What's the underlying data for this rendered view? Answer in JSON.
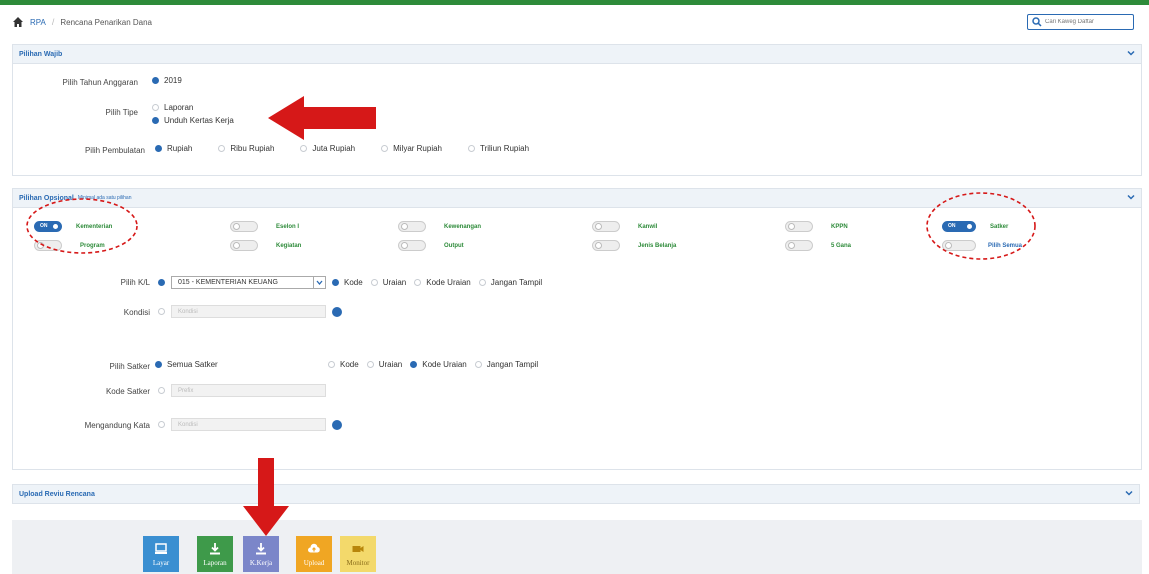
{
  "breadcrumb": {
    "root": "RPA",
    "current": "Rencana Penarikan Dana"
  },
  "search": {
    "placeholder": "Cari Kaweg Daftar"
  },
  "wajib": {
    "title": "Pilihan Wajib",
    "tahun_label": "Pilih Tahun Anggaran",
    "tahun_value": "2019",
    "tipe_label": "Pilih Tipe",
    "tipe_options": [
      "Laporan",
      "Unduh Kertas Kerja"
    ],
    "tipe_selected": 1,
    "pembulatan_label": "Pilih Pembulatan",
    "pembulatan_options": [
      "Rupiah",
      "Ribu Rupiah",
      "Juta Rupiah",
      "Milyar Rupiah",
      "Triliun Rupiah"
    ],
    "pembulatan_selected": 0
  },
  "opsional": {
    "title": "Pilihan Opsional",
    "subtitle": "Minimal ada satu pilihan",
    "toggles_row1": [
      {
        "label": "Kementerian",
        "on": true,
        "state": "ON"
      },
      {
        "label": "Eselon I",
        "on": false,
        "state": "Off"
      },
      {
        "label": "Kewenangan",
        "on": false,
        "state": "Off"
      },
      {
        "label": "Kanwil",
        "on": false,
        "state": "Off"
      },
      {
        "label": "KPPN",
        "on": false,
        "state": "Off"
      },
      {
        "label": "Satker",
        "on": true,
        "state": "ON"
      }
    ],
    "toggles_row2": [
      {
        "label": "Program",
        "on": false,
        "state": "Off"
      },
      {
        "label": "Kegiatan",
        "on": false,
        "state": "Off"
      },
      {
        "label": "Output",
        "on": false,
        "state": "Off"
      },
      {
        "label": "Jenis Belanja",
        "on": false,
        "state": "Off"
      },
      {
        "label": "5 Gana",
        "on": false,
        "state": "Off"
      },
      {
        "label": "Pilih Semua",
        "on": false,
        "state": "Off"
      }
    ],
    "kl_label": "Pilih K/L",
    "kl_value": "015 - KEMENTERIAN KEUANG",
    "kl_display_options": [
      "Kode",
      "Uraian",
      "Kode Uraian",
      "Jangan Tampil"
    ],
    "kl_display_selected": 0,
    "kondisi_label": "Kondisi",
    "kondisi_placeholder": "Kondisi",
    "satker_label": "Pilih Satker",
    "satker_all": "Semua Satker",
    "satker_display_options": [
      "Kode",
      "Uraian",
      "Kode Uraian",
      "Jangan Tampil"
    ],
    "satker_display_selected": 2,
    "kode_satker_label": "Kode Satker",
    "kode_satker_placeholder": "Prefix",
    "kata_label": "Mengandung Kata",
    "kata_placeholder": "Kondisi"
  },
  "upload": {
    "title": "Upload Reviu Rencana"
  },
  "buttons": [
    {
      "label": "Layar",
      "color": "#3a8fd1",
      "icon": "monitor-icon"
    },
    {
      "label": "Laporan",
      "color": "#3e9a4a",
      "icon": "download-icon"
    },
    {
      "label": "K.Kerja",
      "color": "#7b86c9",
      "icon": "download-icon"
    },
    {
      "label": "Upload",
      "color": "#f0a623",
      "icon": "cloud-upload-icon"
    },
    {
      "label": "Monitor",
      "color": "#f3d96b",
      "icon": "video-icon"
    }
  ],
  "colors": {
    "accent": "#2a6ab3",
    "green": "#2e8b3a",
    "arrow": "#d61818"
  }
}
